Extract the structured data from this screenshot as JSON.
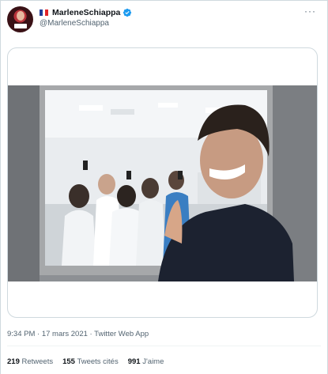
{
  "user": {
    "display_name": "MarleneSchiappa",
    "handle": "@MarleneSchiappa",
    "avatar_icon": "profile-avatar",
    "flag_icon": "france-flag-icon",
    "verified_icon": "verified-badge-icon",
    "verified_color": "#1d9bf0"
  },
  "menu": {
    "more_icon": "more-options-icon",
    "label": "···"
  },
  "media": {
    "type": "photo",
    "subject_icon": "embedded-photo"
  },
  "tweet": {
    "timestamp": "9:34 PM · 17 mars 2021 · Twitter Web App"
  },
  "stats": [
    {
      "count": "219",
      "label": "Retweets"
    },
    {
      "count": "155",
      "label": "Tweets cités"
    },
    {
      "count": "991",
      "label": "J'aime"
    }
  ],
  "colors": {
    "text": "#0f1419",
    "secondary": "#536471",
    "border": "#cfd9de"
  }
}
